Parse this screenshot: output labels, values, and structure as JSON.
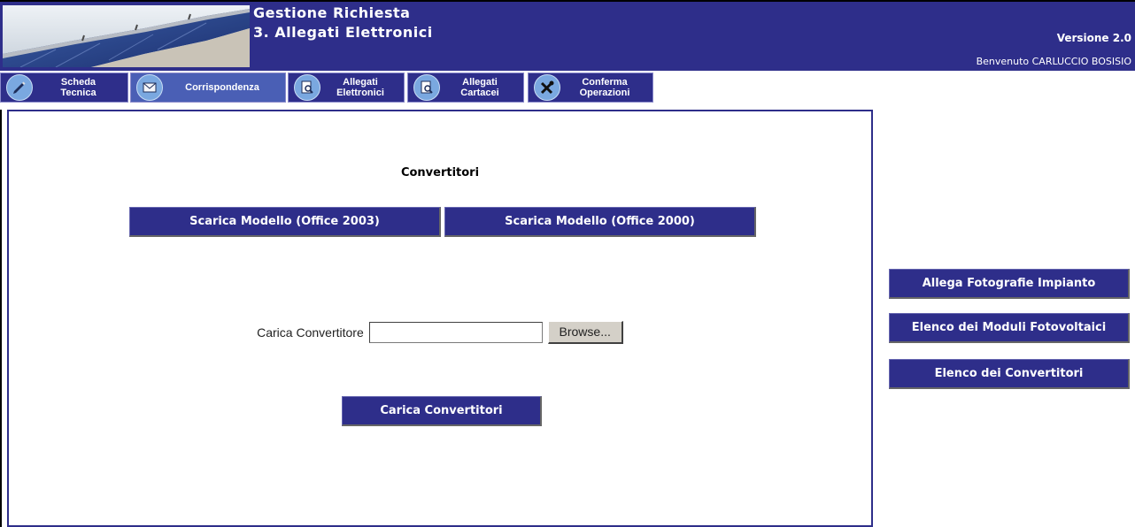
{
  "header": {
    "title_line1": "Gestione Richiesta",
    "title_line2": "3. Allegati Elettronici",
    "version": "Versione 2.0",
    "welcome": "Benvenuto CARLUCCIO BOSISIO"
  },
  "tabs": [
    {
      "line1": "Scheda",
      "line2": "Tecnica",
      "icon": "pencil-icon"
    },
    {
      "line1": "Corrispondenza",
      "line2": "",
      "icon": "envelope-icon"
    },
    {
      "line1": "Allegati",
      "line2": "Elettronici",
      "icon": "document-magnifier-icon"
    },
    {
      "line1": "Allegati",
      "line2": "Cartacei",
      "icon": "document-magnifier-icon"
    },
    {
      "line1": "Conferma",
      "line2": "Operazioni",
      "icon": "tools-icon"
    }
  ],
  "main": {
    "section_title": "Convertitori",
    "download_2003": "Scarica Modello (Office 2003)",
    "download_2000": "Scarica Modello (Office 2000)",
    "upload_label": "Carica Convertitore",
    "upload_value": "",
    "browse_label": "Browse...",
    "upload_button": "Carica Convertitori"
  },
  "side": {
    "photos": "Allega Fotografie Impianto",
    "modules": "Elenco dei Moduli Fotovoltaici",
    "converters": "Elenco dei Convertitori"
  },
  "colors": {
    "navy": "#2e2e8a",
    "active_tab": "#4a5fb5",
    "icon_blue": "#7aa8e0"
  }
}
